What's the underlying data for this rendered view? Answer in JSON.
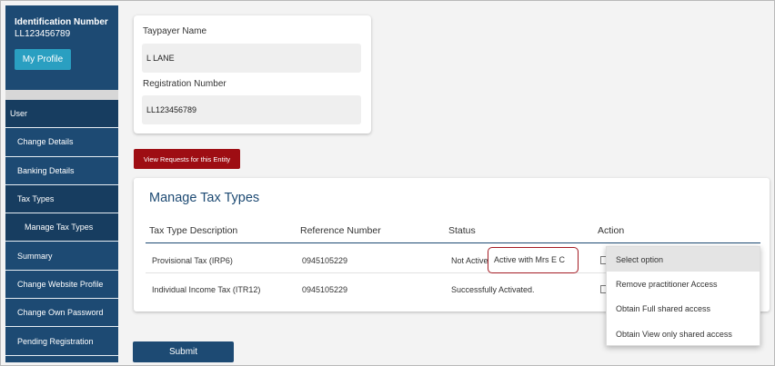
{
  "sidebar": {
    "id_label": "Identification Number",
    "id_value": "LL123456789",
    "profile_button": "My Profile",
    "items": [
      {
        "label": "User"
      },
      {
        "label": "Change Details"
      },
      {
        "label": "Banking Details"
      },
      {
        "label": "Tax Types"
      },
      {
        "label": "Manage Tax Types"
      },
      {
        "label": "Summary"
      },
      {
        "label": "Change Website Profile"
      },
      {
        "label": "Change Own Password"
      },
      {
        "label": "Pending Registration"
      }
    ]
  },
  "taxpayer": {
    "name_label": "Taypayer Name",
    "name_value": "L LANE",
    "reg_label": "Registration Number",
    "reg_value": "LL123456789"
  },
  "view_requests_button": "View Requests for this Entity",
  "manage": {
    "title": "Manage Tax Types",
    "columns": [
      "Tax Type Description",
      "Reference Number",
      "Status",
      "Action"
    ],
    "rows": [
      {
        "description": "Provisional Tax (IRP6)",
        "reference": "0945105229",
        "status": "Not Active",
        "status_overlay": "Active with Mrs E C"
      },
      {
        "description": "Individual Income Tax (ITR12)",
        "reference": "0945105229",
        "status": "Successfully Activated."
      }
    ]
  },
  "dropdown": {
    "options": [
      "Select option",
      "Remove practitioner Access",
      "Obtain Full shared access",
      "Obtain View only shared access"
    ]
  },
  "submit_button": "Submit",
  "colors": {
    "primary": "#1d4a73",
    "danger": "#9e0d13",
    "profile": "#2a9fc1"
  }
}
